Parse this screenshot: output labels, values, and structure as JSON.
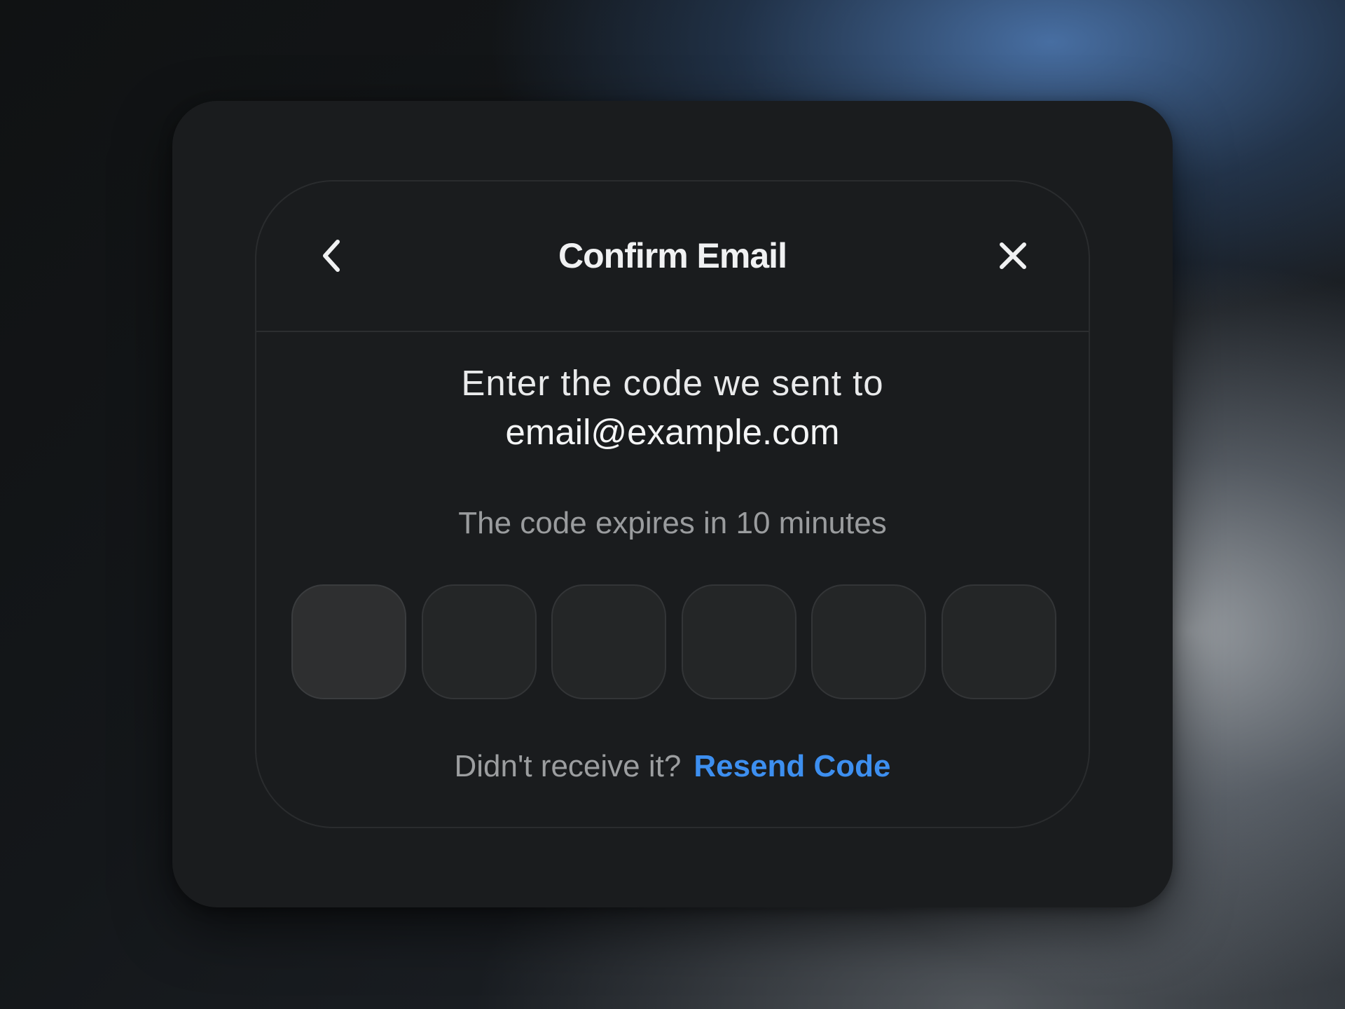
{
  "dialog": {
    "title": "Confirm Email",
    "back_icon": "chevron-left-icon",
    "close_icon": "close-icon"
  },
  "body": {
    "prompt": "Enter the code we sent to",
    "email": "email@example.com",
    "expires_text": "The code expires in 10 minutes"
  },
  "code_input": {
    "digits": [
      "",
      "",
      "",
      "",
      "",
      ""
    ],
    "active_index": 0
  },
  "resend": {
    "prompt": "Didn't receive it?",
    "link_label": "Resend Code"
  },
  "colors": {
    "accent": "#3d8ff0",
    "card_background": "#1a1c1e",
    "title_text": "#f0f1f2",
    "muted_text": "#9a9c9e"
  }
}
